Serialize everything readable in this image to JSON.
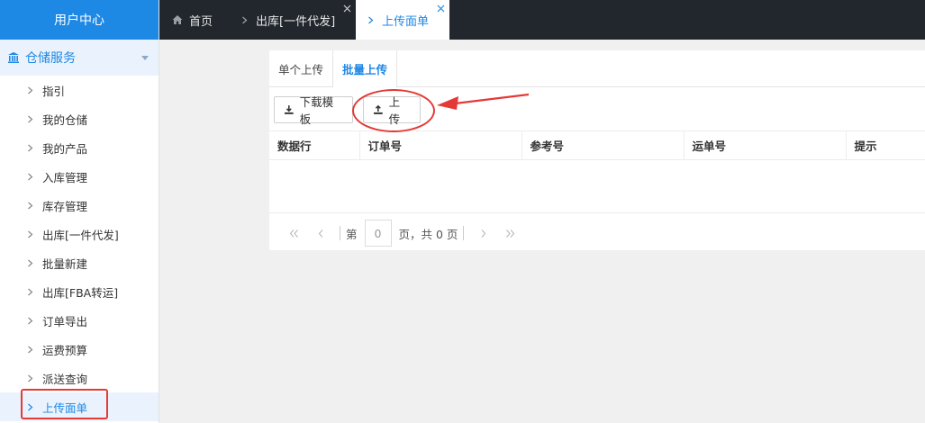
{
  "sidebar": {
    "header": "用户中心",
    "group": "仓储服务",
    "items": [
      {
        "label": "指引"
      },
      {
        "label": "我的仓储"
      },
      {
        "label": "我的产品"
      },
      {
        "label": "入库管理"
      },
      {
        "label": "库存管理"
      },
      {
        "label": "出库[一件代发]"
      },
      {
        "label": "批量新建"
      },
      {
        "label": "出库[FBA转运]"
      },
      {
        "label": "订单导出"
      },
      {
        "label": "运费预算"
      },
      {
        "label": "派送查询"
      },
      {
        "label": "上传面单",
        "active": true
      }
    ]
  },
  "topbar": {
    "tabs": [
      {
        "label": "首页"
      },
      {
        "label": "出库[一件代发]"
      },
      {
        "label": "上传面单",
        "active": true
      }
    ]
  },
  "main": {
    "subtabs": [
      {
        "label": "单个上传"
      },
      {
        "label": "批量上传",
        "active": true
      }
    ],
    "toolbar": {
      "download_label": "下载模板",
      "upload_label": "上传"
    },
    "table": {
      "columns": [
        "数据行",
        "订单号",
        "参考号",
        "运单号",
        "提示"
      ]
    },
    "pager": {
      "prefix": "第",
      "page_value": "0",
      "suffix": "页，共 0 页"
    }
  },
  "colors": {
    "accent": "#1e88e5",
    "topbar_bg": "#22272e",
    "annotation_red": "#e53935"
  }
}
